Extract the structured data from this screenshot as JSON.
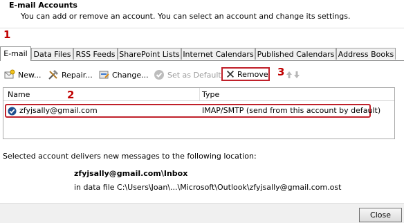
{
  "header": {
    "title": "E-mail Accounts",
    "description": "You can add or remove an account. You can select an account and change its settings."
  },
  "annotations": {
    "step1": "1",
    "step2": "2",
    "step3": "3"
  },
  "tabs": [
    {
      "label": "E-mail",
      "active": true
    },
    {
      "label": "Data Files"
    },
    {
      "label": "RSS Feeds"
    },
    {
      "label": "SharePoint Lists"
    },
    {
      "label": "Internet Calendars"
    },
    {
      "label": "Published Calendars"
    },
    {
      "label": "Address Books"
    }
  ],
  "toolbar": {
    "new": "New...",
    "repair": "Repair...",
    "change": "Change...",
    "set_default": "Set as Default",
    "remove": "Remove"
  },
  "list": {
    "columns": {
      "name": "Name",
      "type": "Type"
    },
    "rows": [
      {
        "name": "zfyjsally@gmail.com",
        "type": "IMAP/SMTP (send from this account by default)"
      }
    ]
  },
  "info": {
    "label": "Selected account delivers new messages to the following location:",
    "inbox": "zfyjsally@gmail.com\\Inbox",
    "file": "in data file C:\\Users\\Joan\\...\\Microsoft\\Outlook\\zfyjsally@gmail.com.ost"
  },
  "footer": {
    "close": "Close"
  },
  "colors": {
    "annotation_red": "#c0202a",
    "text": "#000000",
    "disabled": "#9a9a9a"
  }
}
